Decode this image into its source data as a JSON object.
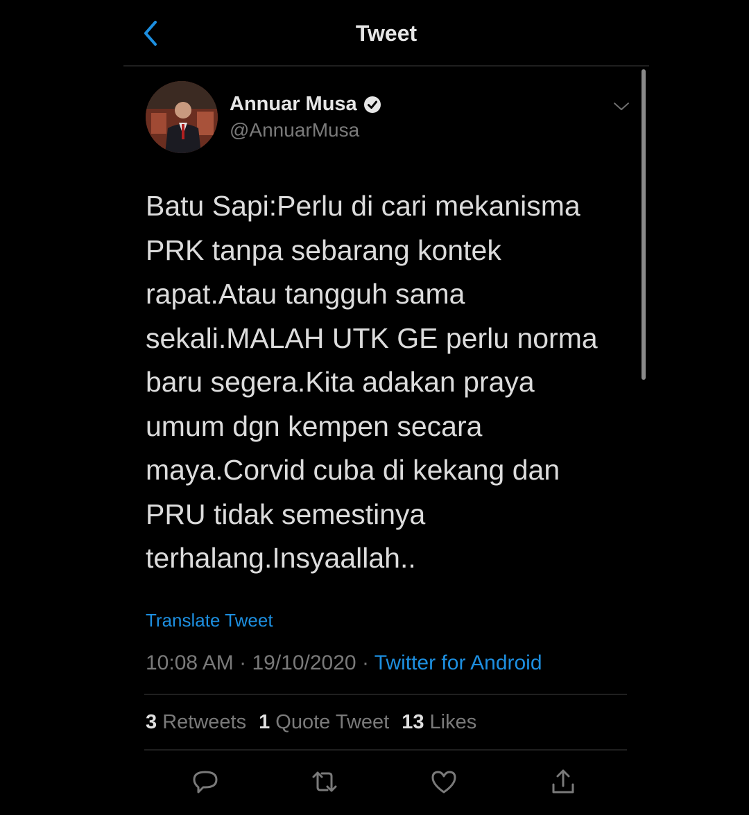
{
  "header": {
    "title": "Tweet",
    "back_icon": "chevron-left-icon"
  },
  "author": {
    "name": "Annuar Musa",
    "handle": "@AnnuarMusa",
    "verified": true
  },
  "tweet": {
    "text": "Batu Sapi:Perlu di cari mekanisma\nPRK tanpa sebarang kontek\nrapat.Atau tangguh sama\nsekali.MALAH UTK GE perlu norma\nbaru segera.Kita adakan praya\numum dgn kempen secara\nmaya.Corvid cuba di kekang dan\nPRU tidak semestinya\nterhalang.Insyaallah..",
    "translate_label": "Translate Tweet",
    "time": "10:08 AM",
    "separator": "·",
    "date": "19/10/2020",
    "source": "Twitter for Android"
  },
  "stats": {
    "retweets_count": "3",
    "retweets_label": "Retweets",
    "quotes_count": "1",
    "quotes_label": "Quote Tweet",
    "likes_count": "13",
    "likes_label": "Likes"
  },
  "actions": [
    "reply-icon",
    "retweet-icon",
    "like-icon",
    "share-icon"
  ],
  "colors": {
    "background": "#000000",
    "accent": "#1d8fe0",
    "text_primary": "#dcdcdc",
    "text_secondary": "#7a7a7a",
    "divider": "#1f1f1f"
  }
}
